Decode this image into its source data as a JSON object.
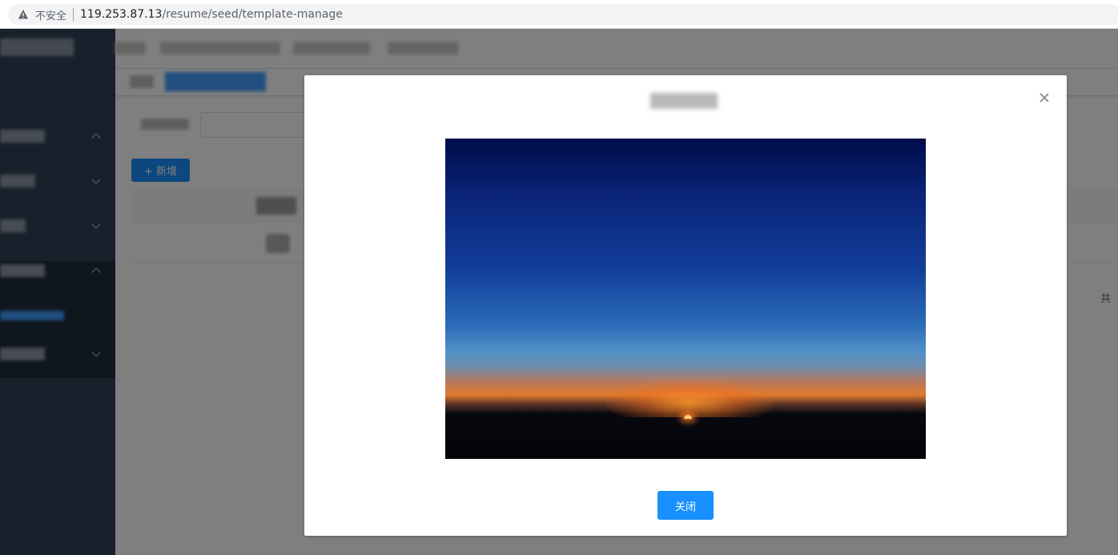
{
  "browser": {
    "insecure_label": "不安全",
    "url_host": "119.253.87.13",
    "url_path": "/resume/seed/template-manage"
  },
  "toolbar": {
    "add_label": "+ 新增"
  },
  "pagination": {
    "total_prefix": "共"
  },
  "dialog": {
    "close_button_label": "关闭"
  },
  "colors": {
    "primary": "#1890ff",
    "sidebar": "#304156"
  }
}
